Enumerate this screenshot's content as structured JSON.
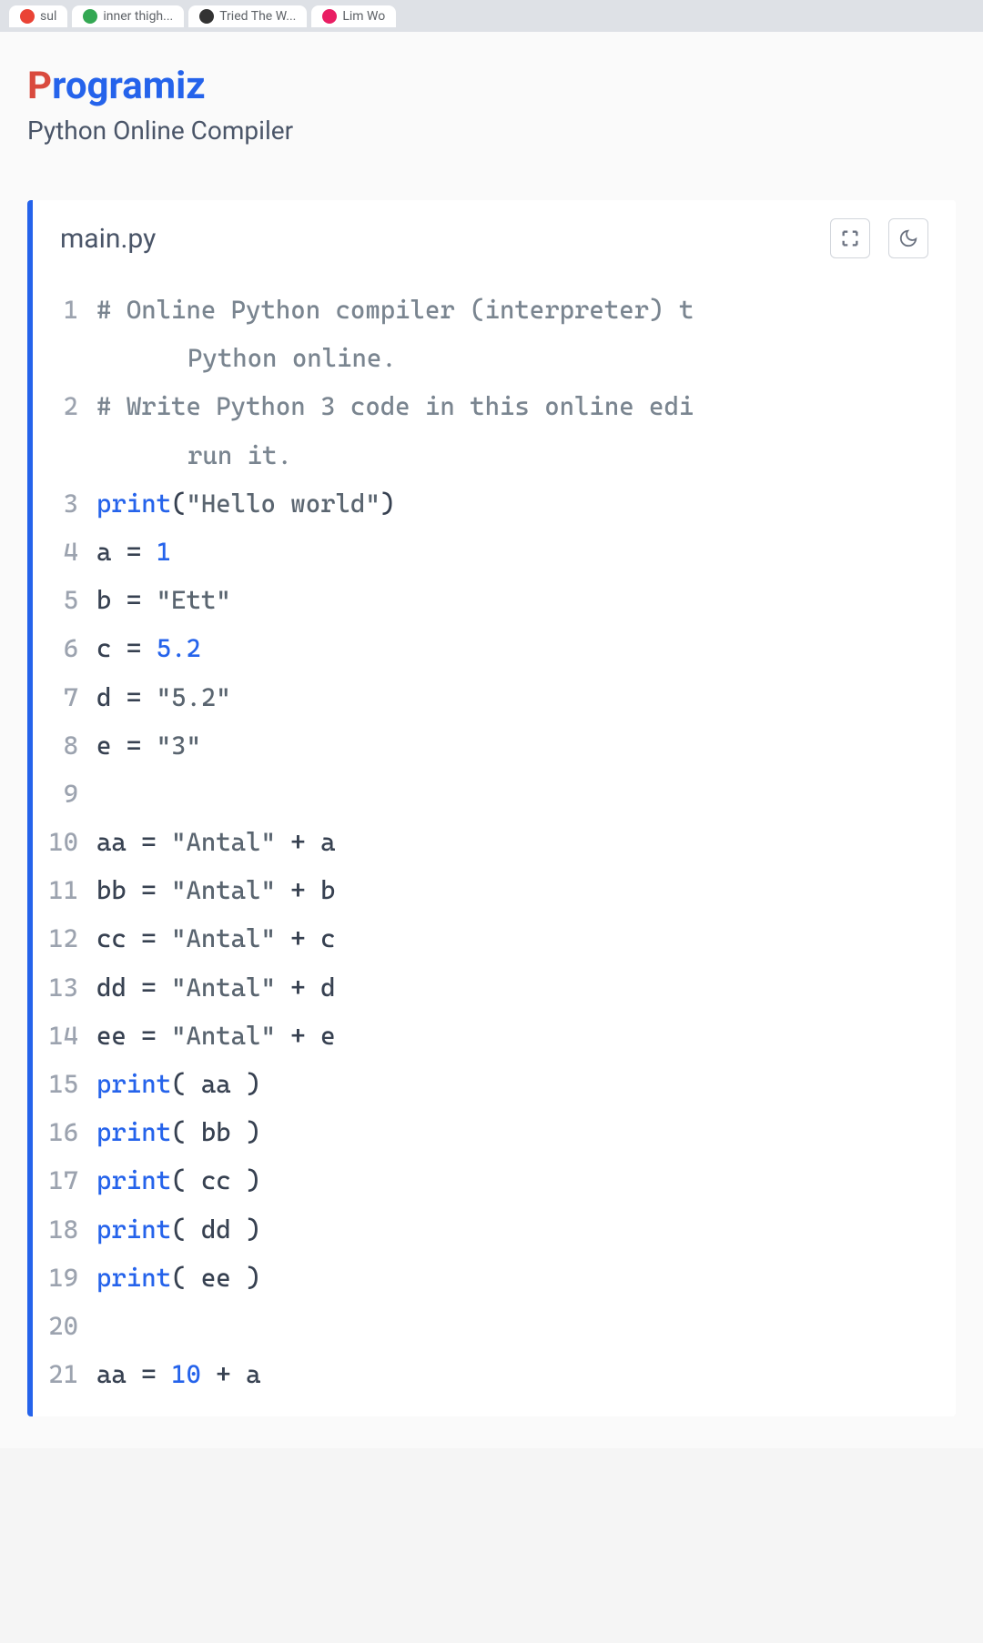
{
  "browser": {
    "tabs": [
      {
        "label": "sul"
      },
      {
        "label": "inner thigh..."
      },
      {
        "label": "Tried The W..."
      },
      {
        "label": "Lim Wo"
      }
    ]
  },
  "header": {
    "logo_first": "P",
    "logo_rest": "rogramiz",
    "subtitle": "Python Online Compiler"
  },
  "editor": {
    "filename": "main.py",
    "lines": [
      {
        "num": "1",
        "type": "comment",
        "text": "# Online Python compiler (interpreter) t",
        "wrap": "Python online."
      },
      {
        "num": "2",
        "type": "comment",
        "text": "# Write Python 3 code in this online edi",
        "wrap": "run it."
      },
      {
        "num": "3",
        "parts": [
          {
            "t": "func",
            "v": "print"
          },
          {
            "t": "plain",
            "v": "("
          },
          {
            "t": "string",
            "v": "\"Hello world\""
          },
          {
            "t": "plain",
            "v": ")"
          }
        ]
      },
      {
        "num": "4",
        "parts": [
          {
            "t": "plain",
            "v": "a = "
          },
          {
            "t": "number",
            "v": "1"
          }
        ]
      },
      {
        "num": "5",
        "parts": [
          {
            "t": "plain",
            "v": "b = "
          },
          {
            "t": "string",
            "v": "\"Ett\""
          }
        ]
      },
      {
        "num": "6",
        "parts": [
          {
            "t": "plain",
            "v": "c = "
          },
          {
            "t": "number",
            "v": "5.2"
          }
        ]
      },
      {
        "num": "7",
        "parts": [
          {
            "t": "plain",
            "v": "d = "
          },
          {
            "t": "string",
            "v": "\"5.2\""
          }
        ]
      },
      {
        "num": "8",
        "parts": [
          {
            "t": "plain",
            "v": "e = "
          },
          {
            "t": "string",
            "v": "\"3\""
          }
        ]
      },
      {
        "num": "9",
        "parts": []
      },
      {
        "num": "10",
        "parts": [
          {
            "t": "plain",
            "v": "aa = "
          },
          {
            "t": "string",
            "v": "\"Antal\""
          },
          {
            "t": "plain",
            "v": " + a"
          }
        ]
      },
      {
        "num": "11",
        "parts": [
          {
            "t": "plain",
            "v": "bb = "
          },
          {
            "t": "string",
            "v": "\"Antal\""
          },
          {
            "t": "plain",
            "v": " + b"
          }
        ]
      },
      {
        "num": "12",
        "parts": [
          {
            "t": "plain",
            "v": "cc = "
          },
          {
            "t": "string",
            "v": "\"Antal\""
          },
          {
            "t": "plain",
            "v": " + c"
          }
        ]
      },
      {
        "num": "13",
        "parts": [
          {
            "t": "plain",
            "v": "dd = "
          },
          {
            "t": "string",
            "v": "\"Antal\""
          },
          {
            "t": "plain",
            "v": " + d"
          }
        ]
      },
      {
        "num": "14",
        "parts": [
          {
            "t": "plain",
            "v": "ee = "
          },
          {
            "t": "string",
            "v": "\"Antal\""
          },
          {
            "t": "plain",
            "v": " + e"
          }
        ]
      },
      {
        "num": "15",
        "parts": [
          {
            "t": "func",
            "v": "print"
          },
          {
            "t": "plain",
            "v": "( aa )"
          }
        ]
      },
      {
        "num": "16",
        "parts": [
          {
            "t": "func",
            "v": "print"
          },
          {
            "t": "plain",
            "v": "( bb )"
          }
        ]
      },
      {
        "num": "17",
        "parts": [
          {
            "t": "func",
            "v": "print"
          },
          {
            "t": "plain",
            "v": "( cc )"
          }
        ]
      },
      {
        "num": "18",
        "parts": [
          {
            "t": "func",
            "v": "print"
          },
          {
            "t": "plain",
            "v": "( dd )"
          }
        ]
      },
      {
        "num": "19",
        "parts": [
          {
            "t": "func",
            "v": "print"
          },
          {
            "t": "plain",
            "v": "( ee )"
          }
        ]
      },
      {
        "num": "20",
        "parts": []
      },
      {
        "num": "21",
        "parts": [
          {
            "t": "plain",
            "v": "aa = "
          },
          {
            "t": "number",
            "v": "10"
          },
          {
            "t": "plain",
            "v": " + a"
          }
        ]
      }
    ]
  }
}
